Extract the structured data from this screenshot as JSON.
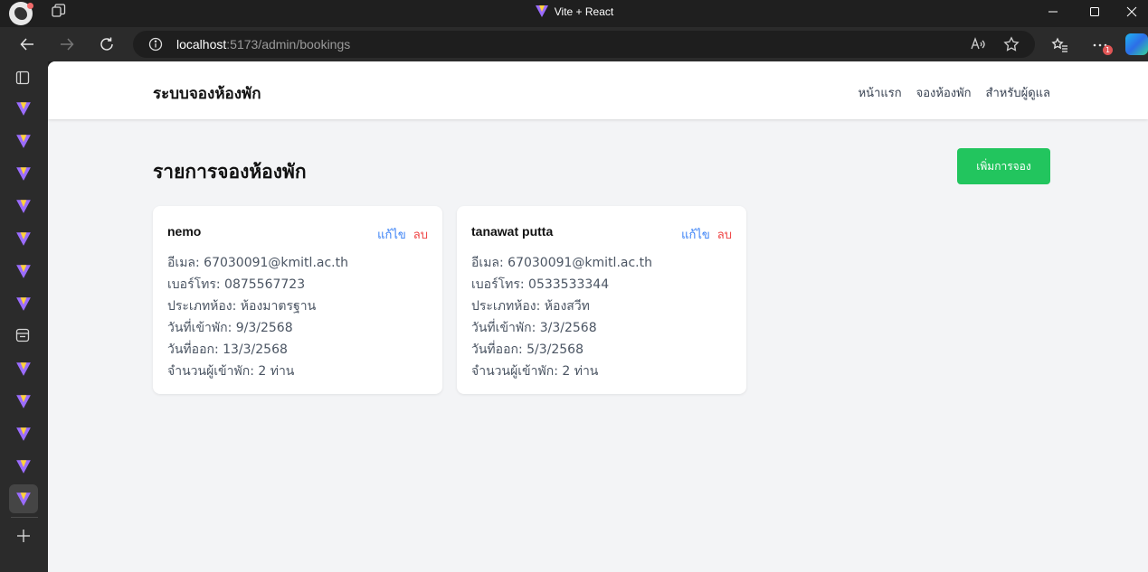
{
  "window": {
    "title": "Vite + React"
  },
  "browser": {
    "url_host": "localhost",
    "url_rest": ":5173/admin/bookings",
    "notification_count": "1"
  },
  "page": {
    "brand": "ระบบจองห้องพัก",
    "nav": [
      {
        "label": "หน้าแรก"
      },
      {
        "label": "จองห้องพัก"
      },
      {
        "label": "สำหรับผู้ดูแล"
      }
    ],
    "heading": "รายการจองห้องพัก",
    "add_button": "เพิ่มการจอง",
    "bookings": [
      {
        "name": "nemo",
        "edit_label": "แก้ไข",
        "delete_label": "ลบ",
        "email": "อีเมล: 67030091@kmitl.ac.th",
        "phone": "เบอร์โทร: 0875567723",
        "room_type": "ประเภทห้อง: ห้องมาตรฐาน",
        "check_in": "วันที่เข้าพัก: 9/3/2568",
        "check_out": "วันที่ออก: 13/3/2568",
        "guests": "จำนวนผู้เข้าพัก: 2 ท่าน"
      },
      {
        "name": "tanawat putta",
        "edit_label": "แก้ไข",
        "delete_label": "ลบ",
        "email": "อีเมล: 67030091@kmitl.ac.th",
        "phone": "เบอร์โทร: 0533533344",
        "room_type": "ประเภทห้อง: ห้องสวีท",
        "check_in": "วันที่เข้าพัก: 3/3/2568",
        "check_out": "วันที่ออก: 5/3/2568",
        "guests": "จำนวนผู้เข้าพัก: 2 ท่าน"
      }
    ]
  },
  "colors": {
    "accent_green": "#22c55e",
    "link_blue": "#3b82f6",
    "danger_red": "#ef4444",
    "page_bg": "#f3f4f6"
  }
}
